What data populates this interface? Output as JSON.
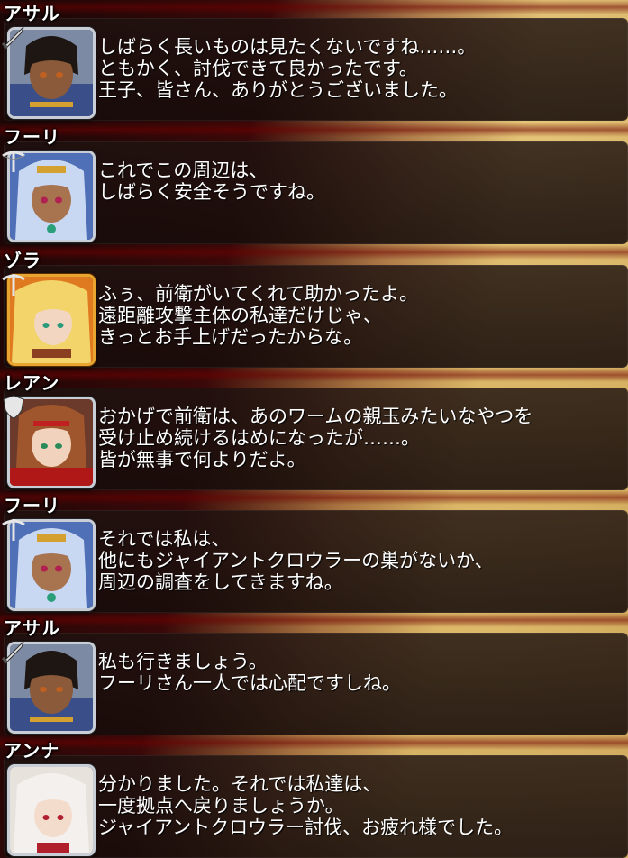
{
  "dialogue": [
    {
      "speaker": "アサル",
      "portrait": "asal-portrait",
      "class_icon": "sword-icon",
      "lines": [
        "しばらく長いものは見たくないですね……。",
        "ともかく、討伐できて良かったです。",
        "王子、皆さん、ありがとうございました。"
      ]
    },
    {
      "speaker": "フーリ",
      "portrait": "fuuri-portrait",
      "class_icon": "crossbow-icon",
      "lines": [
        "これでこの周辺は、",
        "しばらく安全そうですね。"
      ]
    },
    {
      "speaker": "ゾラ",
      "portrait": "zora-portrait",
      "class_icon": "crossbow-icon",
      "lines": [
        "ふぅ、前衛がいてくれて助かったよ。",
        "遠距離攻撃主体の私達だけじゃ、",
        "きっとお手上げだったからな。"
      ]
    },
    {
      "speaker": "レアン",
      "portrait": "rean-portrait",
      "class_icon": "shield-icon",
      "lines": [
        "おかげで前衛は、あのワームの親玉みたいなやつを",
        "受け止め続けるはめになったが……。",
        "皆が無事で何よりだよ。"
      ]
    },
    {
      "speaker": "フーリ",
      "portrait": "fuuri-portrait",
      "class_icon": "crossbow-icon",
      "lines": [
        "それでは私は、",
        "他にもジャイアントクロウラーの巣がないか、",
        "周辺の調査をしてきますね。"
      ]
    },
    {
      "speaker": "アサル",
      "portrait": "asal-portrait",
      "class_icon": "sword-icon",
      "lines": [
        "私も行きましょう。",
        "フーリさん一人では心配ですしね。"
      ]
    },
    {
      "speaker": "アンナ",
      "portrait": "anna-portrait",
      "class_icon": "",
      "lines": [
        "分かりました。それでは私達は、",
        "一度拠点へ戻りましょうか。",
        "ジャイアントクロウラー討伐、お疲れ様でした。"
      ]
    }
  ],
  "colors": {
    "text": "#ffffff",
    "box": "#1e1210",
    "frame_silver": "#c8cdd6",
    "frame_gold": "#e8a530"
  }
}
